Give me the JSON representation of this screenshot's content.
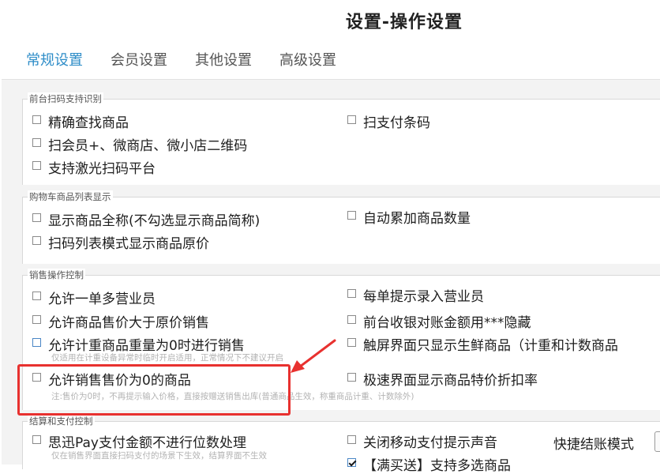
{
  "header": {
    "title": "设置-操作设置"
  },
  "tabs": [
    {
      "label": "常规设置",
      "active": true
    },
    {
      "label": "会员设置",
      "active": false
    },
    {
      "label": "其他设置",
      "active": false
    },
    {
      "label": "高级设置",
      "active": false
    }
  ],
  "sections": {
    "scan": {
      "legend": "前台扫码支持识别",
      "options": [
        {
          "label": "精确查找商品",
          "checked": false
        },
        {
          "label": "扫支付条码",
          "checked": false
        },
        {
          "label": "扫会员+、微商店、微小店二维码",
          "checked": false
        },
        {
          "label": "支持激光扫码平台",
          "checked": false
        }
      ]
    },
    "cart": {
      "legend": "购物车商品列表显示",
      "options": [
        {
          "label": "显示商品全称(不勾选显示商品简称)",
          "checked": false
        },
        {
          "label": "自动累加商品数量",
          "checked": false
        },
        {
          "label": "扫码列表模式显示商品原价",
          "checked": false
        }
      ]
    },
    "sales": {
      "legend": "销售操作控制",
      "options": [
        {
          "label": "允许一单多营业员",
          "checked": false
        },
        {
          "label": "每单提示录入营业员",
          "checked": false
        },
        {
          "label": "允许商品售价大于原价销售",
          "checked": false
        },
        {
          "label": "前台收银对账金额用***隐藏",
          "checked": false
        },
        {
          "label": "允许计重商品重量为0时进行销售",
          "checked": false
        },
        {
          "label": "触屏界面只显示生鲜商品（计重和计数商品",
          "checked": false
        },
        {
          "label": "允许销售售价为0的商品",
          "checked": false
        },
        {
          "label": "极速界面显示商品特价折扣率",
          "checked": false
        }
      ],
      "notes": {
        "weight": "仅适用在计重设备异常时临时开启适用，正常情况下不建议开启",
        "zero_price": "注:售价为0时，不再提示输入价格，直接按赠送销售出库(普通商品生效，称重商品计重、计数除外)"
      }
    },
    "payment": {
      "legend": "结算和支付控制",
      "options": [
        {
          "label": "思迅Pay支付金额不进行位数处理",
          "checked": false
        },
        {
          "label": "关闭移动支付提示声音",
          "checked": false
        },
        {
          "label": "【满买送】支持多选商品",
          "checked": true
        }
      ],
      "notes": {
        "pay": "仅在销售界面直接扫码支付的场景下生效，结算界面不生效"
      },
      "quick_checkout_label": "快捷结账模式"
    }
  },
  "colors": {
    "accent": "#2e8dc8",
    "highlight": "#e8312f"
  },
  "icons": {
    "arrow": "red-arrow-icon",
    "checkbox": "checkbox-icon"
  }
}
